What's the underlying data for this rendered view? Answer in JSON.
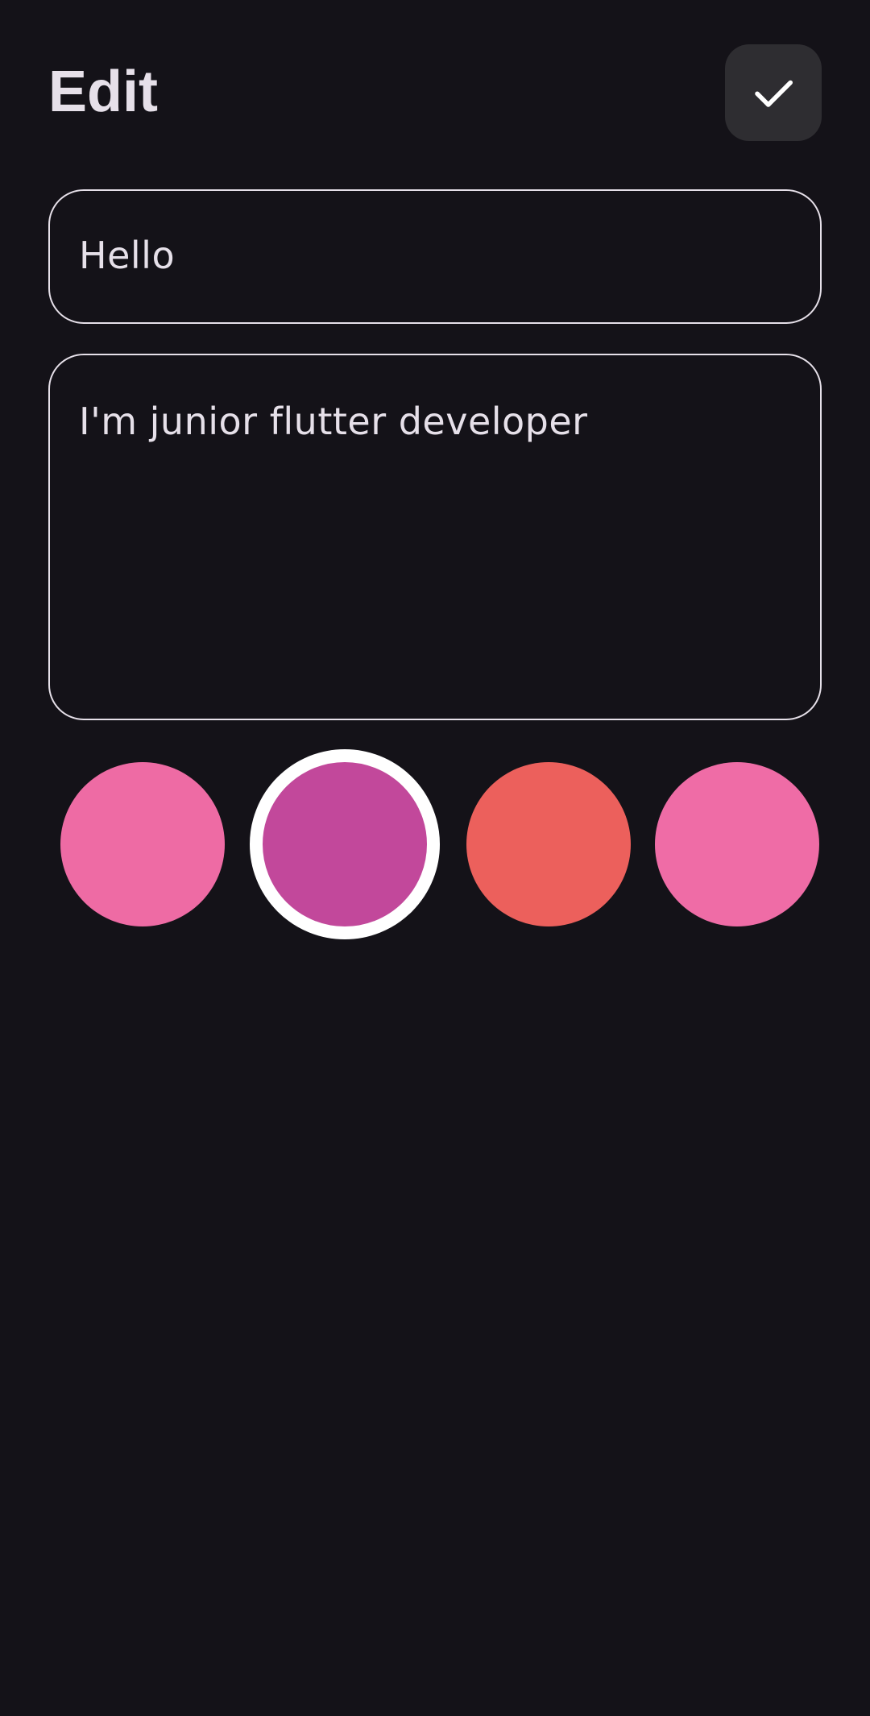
{
  "header": {
    "title": "Edit",
    "save_icon": "check-icon"
  },
  "form": {
    "title_value": "Hello",
    "description_value": "I'm junior flutter developer"
  },
  "colors": {
    "selected_index": 1,
    "swatches": [
      "#EE6BA4",
      "#C2489B",
      "#EC605C",
      "#EF6CA6"
    ]
  },
  "theme": {
    "background": "#141218",
    "text": "#E6E0E9",
    "button_bg": "#2E2D31",
    "border": "#E6E0E9"
  }
}
